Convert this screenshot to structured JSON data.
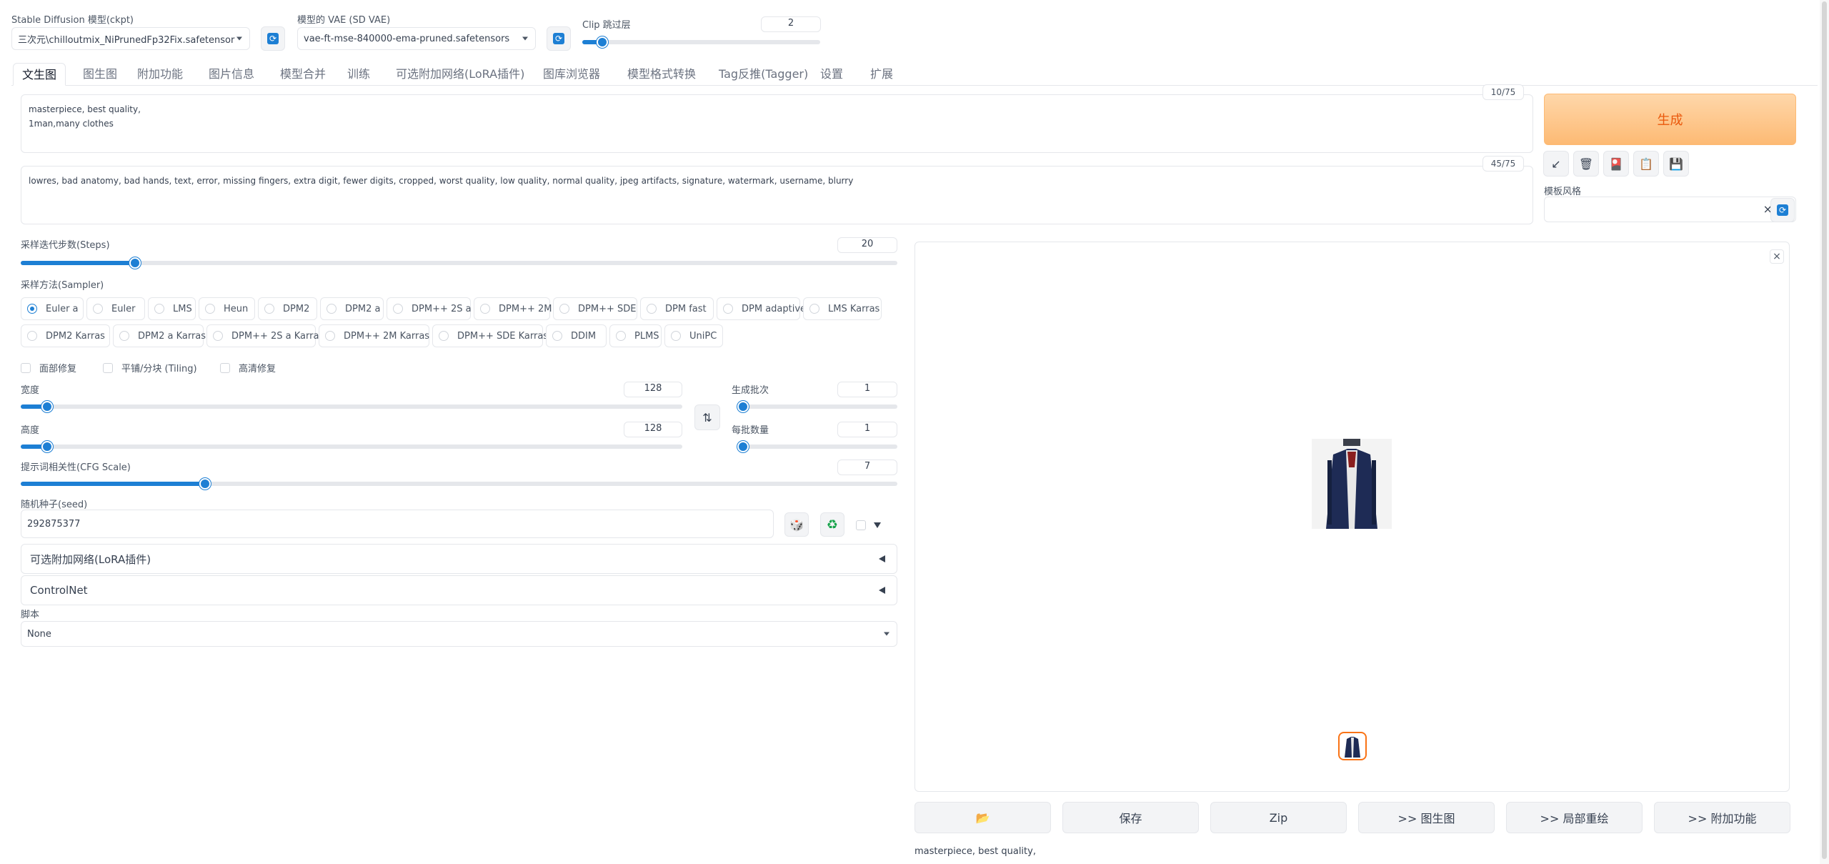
{
  "top": {
    "ckpt_label": "Stable Diffusion 模型(ckpt)",
    "ckpt_value": "三次元\\chilloutmix_NiPrunedFp32Fix.safetensor",
    "vae_label": "模型的 VAE (SD VAE)",
    "vae_value": "vae-ft-mse-840000-ema-pruned.safetensors",
    "clip_label": "Clip 跳过层",
    "clip_value": "2",
    "clip_fraction": 0.083
  },
  "tabs": [
    {
      "label": "文生图",
      "active": true
    },
    {
      "label": "图生图"
    },
    {
      "label": "附加功能"
    },
    {
      "label": "图片信息"
    },
    {
      "label": "模型合并"
    },
    {
      "label": "训练"
    },
    {
      "label": "可选附加网络(LoRA插件)"
    },
    {
      "label": "图库浏览器"
    },
    {
      "label": "模型格式转换"
    },
    {
      "label": "Tag反推(Tagger)"
    },
    {
      "label": "设置"
    },
    {
      "label": "扩展"
    }
  ],
  "prompt": {
    "text": "masterpiece, best quality,\n1man,many clothes",
    "counter": "10/75"
  },
  "negative": {
    "text": "lowres, bad anatomy, bad hands, text, error, missing fingers, extra digit, fewer digits, cropped, worst quality, low quality, normal quality, jpeg artifacts, signature, watermark, username, blurry",
    "counter": "45/75"
  },
  "generate_label": "生成",
  "tools": {
    "apply": "↙",
    "trash": "🗑",
    "card": "🎴",
    "clipboard": "📋",
    "save": "💾"
  },
  "styles": {
    "label": "模板风格",
    "clear": "×"
  },
  "steps": {
    "label": "采样迭代步数(Steps)",
    "value": "20",
    "fraction": 0.13
  },
  "sampler": {
    "label": "采样方法(Sampler)",
    "row1": [
      "Euler a",
      "Euler",
      "LMS",
      "Heun",
      "DPM2",
      "DPM2 a",
      "DPM++ 2S a",
      "DPM++ 2M",
      "DPM++ SDE",
      "DPM fast",
      "DPM adaptive",
      "LMS Karras"
    ],
    "row2": [
      "DPM2 Karras",
      "DPM2 a Karras",
      "DPM++ 2S a Karras",
      "DPM++ 2M Karras",
      "DPM++ SDE Karras",
      "DDIM",
      "PLMS",
      "UniPC"
    ],
    "selected": "Euler a"
  },
  "checks": {
    "face": "面部修复",
    "tiling": "平铺/分块 (Tiling)",
    "hires": "高清修复"
  },
  "width": {
    "label": "宽度",
    "value": "128",
    "fraction": 0.04
  },
  "height": {
    "label": "高度",
    "value": "128",
    "fraction": 0.04
  },
  "swap_icon": "⇅",
  "batch_count": {
    "label": "生成批次",
    "value": "1",
    "fraction": 0.0
  },
  "batch_size": {
    "label": "每批数量",
    "value": "1",
    "fraction": 0.0
  },
  "cfg": {
    "label": "提示词相关性(CFG Scale)",
    "value": "7",
    "fraction": 0.21
  },
  "seed": {
    "label": "随机种子(seed)",
    "value": "292875377",
    "dice_icon": "🎲",
    "recycle_icon": "♻"
  },
  "accordions": {
    "lora": "可选附加网络(LoRA插件)",
    "controlnet": "ControlNet"
  },
  "script": {
    "label": "脚本",
    "value": "None"
  },
  "output": {
    "close": "×",
    "folder_icon": "📂",
    "buttons": [
      "保存",
      "Zip",
      ">> 图生图",
      ">> 局部重绘",
      ">> 附加功能"
    ],
    "info": "masterpiece, best quality,"
  }
}
